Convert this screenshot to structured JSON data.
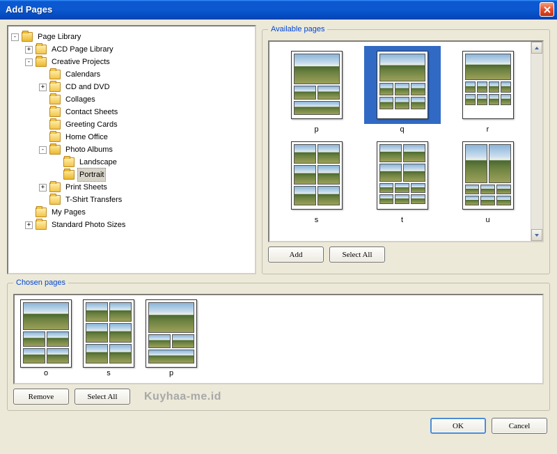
{
  "title": "Add Pages",
  "tree": {
    "root": "Page Library",
    "acd": "ACD Page Library",
    "creative": "Creative Projects",
    "calendars": "Calendars",
    "cddvd": "CD and DVD",
    "collages": "Collages",
    "contact": "Contact Sheets",
    "greeting": "Greeting Cards",
    "home": "Home Office",
    "albums": "Photo Albums",
    "landscape": "Landscape",
    "portrait": "Portrait",
    "print": "Print Sheets",
    "tshirt": "T-Shirt Transfers",
    "mypages": "My Pages",
    "standard": "Standard Photo Sizes"
  },
  "groups": {
    "available": "Available pages",
    "chosen": "Chosen pages"
  },
  "available": {
    "p": "p",
    "q": "q",
    "r": "r",
    "s": "s",
    "t": "t",
    "u": "u"
  },
  "chosen": {
    "o": "o",
    "s": "s",
    "p": "p"
  },
  "buttons": {
    "add": "Add",
    "selectAll": "Select All",
    "remove": "Remove",
    "ok": "OK",
    "cancel": "Cancel"
  },
  "watermark": "Kuyhaa-me.id"
}
